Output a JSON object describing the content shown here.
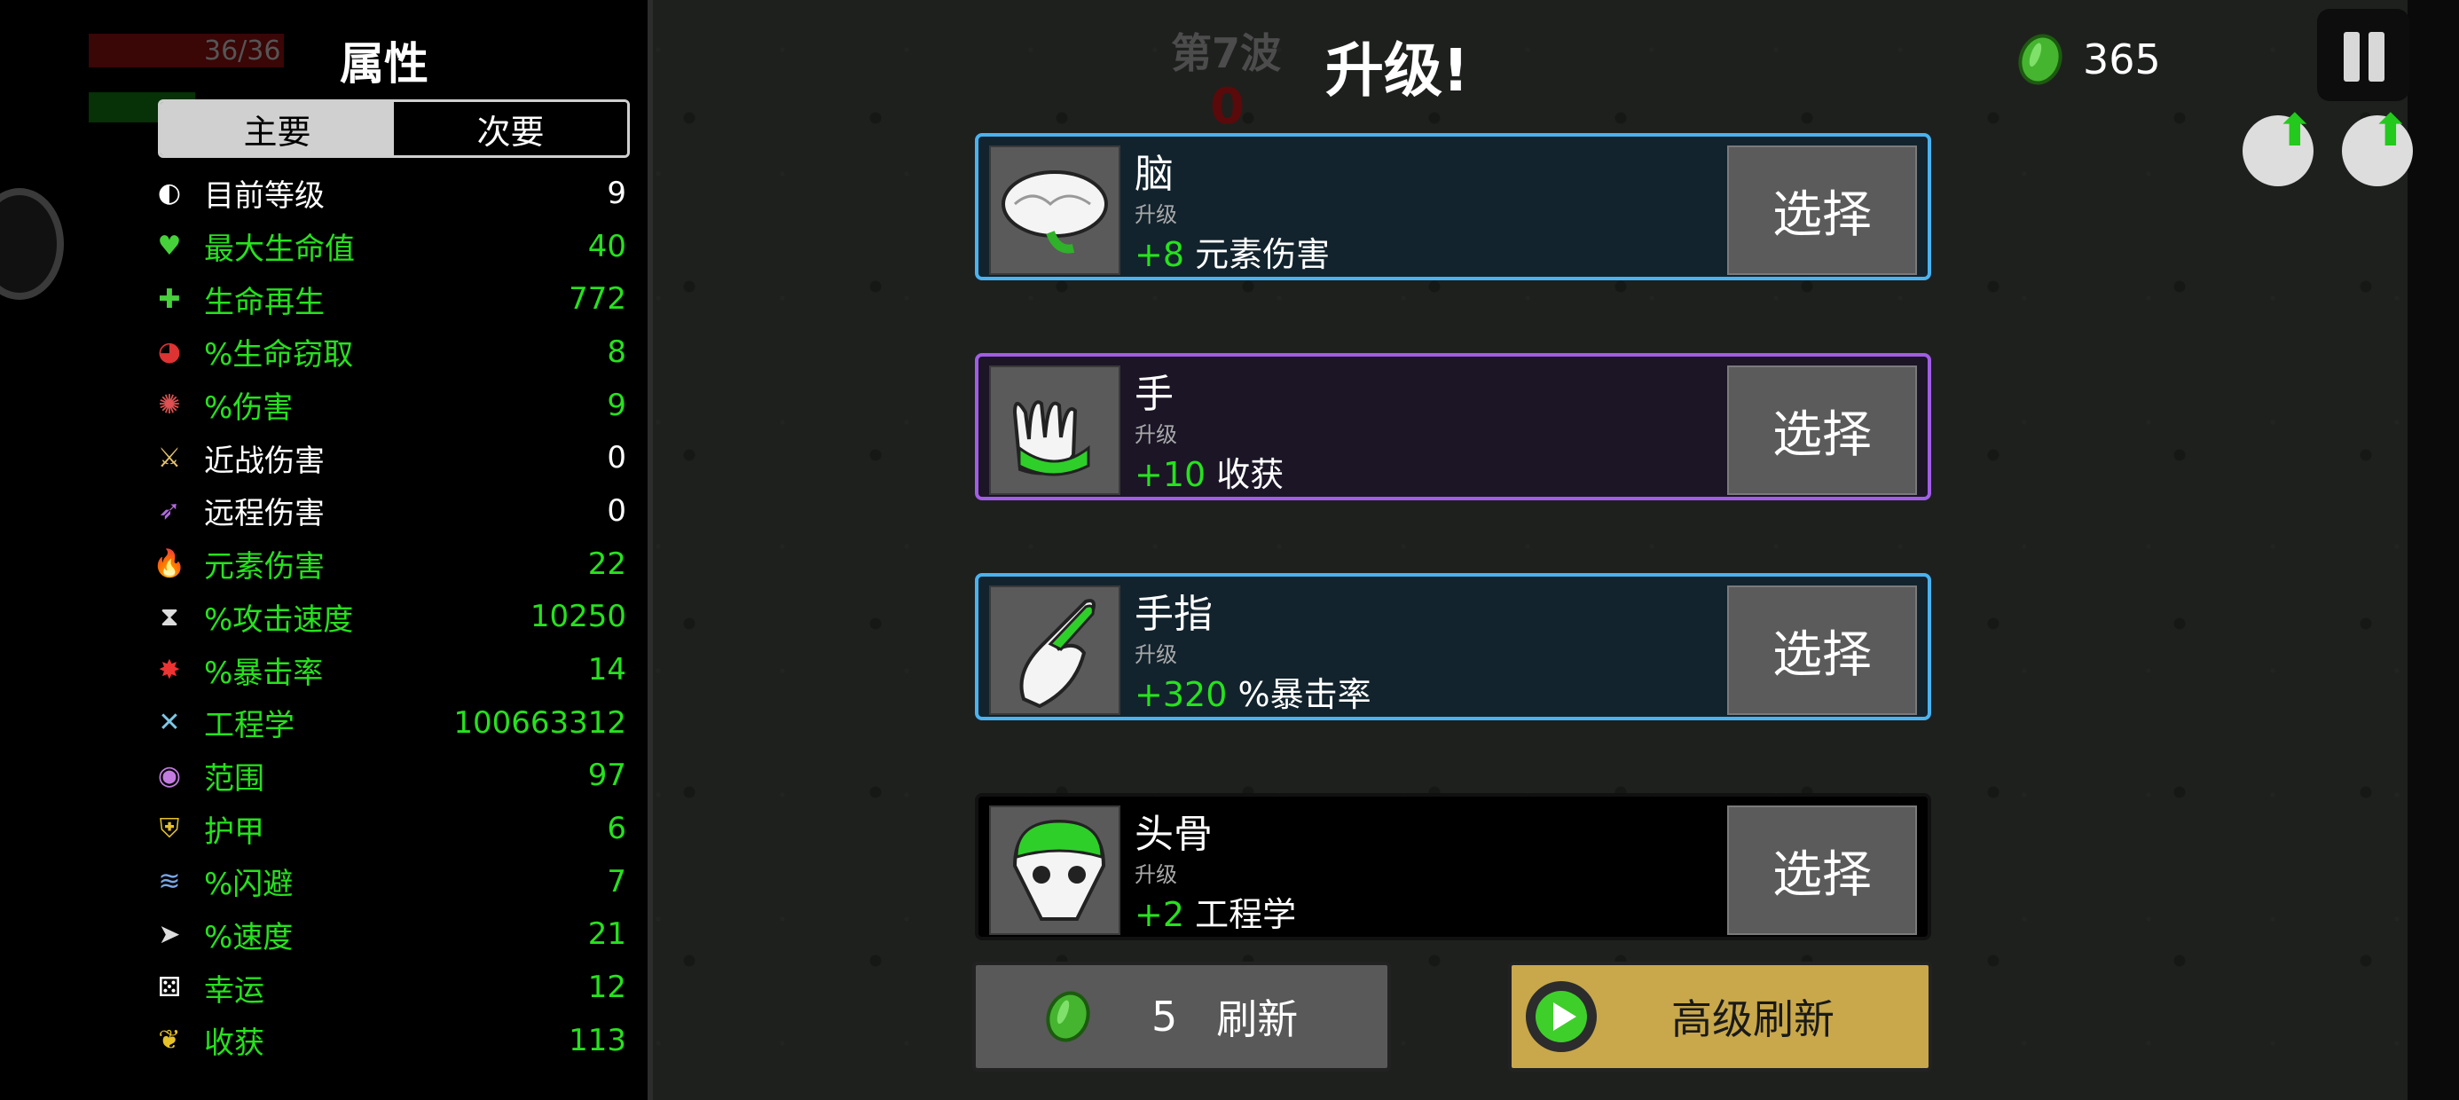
{
  "hud": {
    "hp_text": "36/36"
  },
  "stats_panel": {
    "title": "属性",
    "tabs": [
      {
        "label": "主要",
        "active": true
      },
      {
        "label": "次要",
        "active": false
      }
    ],
    "rows": [
      {
        "icon": "level-icon",
        "name": "目前等级",
        "value": "9",
        "color": "#ffffff"
      },
      {
        "icon": "heart-icon",
        "name": "最大生命值",
        "value": "40",
        "color": "#26e21d"
      },
      {
        "icon": "regen-icon",
        "name": "生命再生",
        "value": "772",
        "color": "#26e21d"
      },
      {
        "icon": "lifesteal-icon",
        "name": "%生命窃取",
        "value": "8",
        "color": "#26e21d"
      },
      {
        "icon": "damage-icon",
        "name": "%伤害",
        "value": "9",
        "color": "#26e21d"
      },
      {
        "icon": "melee-icon",
        "name": "近战伤害",
        "value": "0",
        "color": "#ffffff"
      },
      {
        "icon": "ranged-icon",
        "name": "远程伤害",
        "value": "0",
        "color": "#ffffff"
      },
      {
        "icon": "elemental-icon",
        "name": "元素伤害",
        "value": "22",
        "color": "#26e21d"
      },
      {
        "icon": "hourglass-icon",
        "name": "%攻击速度",
        "value": "10250",
        "color": "#26e21d"
      },
      {
        "icon": "crit-icon",
        "name": "%暴击率",
        "value": "14",
        "color": "#26e21d"
      },
      {
        "icon": "wrench-icon",
        "name": "工程学",
        "value": "100663312",
        "color": "#26e21d"
      },
      {
        "icon": "range-icon",
        "name": "范围",
        "value": "97",
        "color": "#26e21d"
      },
      {
        "icon": "shield-icon",
        "name": "护甲",
        "value": "6",
        "color": "#26e21d"
      },
      {
        "icon": "dodge-icon",
        "name": "%闪避",
        "value": "7",
        "color": "#26e21d"
      },
      {
        "icon": "speed-icon",
        "name": "%速度",
        "value": "21",
        "color": "#26e21d"
      },
      {
        "icon": "dice-icon",
        "name": "幸运",
        "value": "12",
        "color": "#26e21d"
      },
      {
        "icon": "harvest-icon",
        "name": "收获",
        "value": "113",
        "color": "#26e21d"
      }
    ]
  },
  "top": {
    "wave_label": "第7波",
    "wave_timer": "0",
    "title": "升级!",
    "materials": "365"
  },
  "upgrades": [
    {
      "name": "脑",
      "sub": "升级",
      "amount": "+8",
      "stat": "元素伤害",
      "border": "#4ab3ef",
      "bg": "#12232d",
      "icon": "brain-icon",
      "choose": "选择"
    },
    {
      "name": "手",
      "sub": "升级",
      "amount": "+10",
      "stat": "收获",
      "border": "#a25de6",
      "bg": "#1b1526",
      "icon": "hand-icon",
      "choose": "选择"
    },
    {
      "name": "手指",
      "sub": "升级",
      "amount": "+320",
      "stat": "%暴击率",
      "border": "#4ab3ef",
      "bg": "#12232d",
      "icon": "finger-icon",
      "choose": "选择"
    },
    {
      "name": "头骨",
      "sub": "升级",
      "amount": "+2",
      "stat": "工程学",
      "border": "#111111",
      "bg": "#000000",
      "icon": "skull-icon",
      "choose": "选择"
    }
  ],
  "reroll": {
    "cost": "5",
    "label": "刷新"
  },
  "premium_reroll": {
    "label": "高级刷新"
  }
}
